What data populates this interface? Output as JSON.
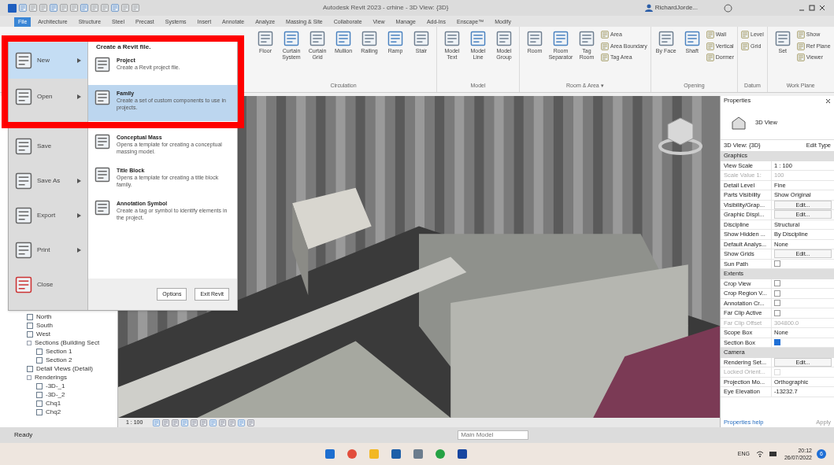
{
  "window": {
    "title": "Autodesk Revit 2023 - crhine - 3D View: {3D}",
    "user": "RichardJorde..."
  },
  "tabs": [
    {
      "label": "File",
      "selected": true
    },
    {
      "label": "Architecture",
      "selected": false
    },
    {
      "label": "Structure",
      "selected": false
    },
    {
      "label": "Steel",
      "selected": false
    },
    {
      "label": "Precast",
      "selected": false
    },
    {
      "label": "Systems",
      "selected": false
    },
    {
      "label": "Insert",
      "selected": false
    },
    {
      "label": "Annotate",
      "selected": false
    },
    {
      "label": "Analyze",
      "selected": false
    },
    {
      "label": "Massing & Site",
      "selected": false
    },
    {
      "label": "Collaborate",
      "selected": false
    },
    {
      "label": "View",
      "selected": false
    },
    {
      "label": "Manage",
      "selected": false
    },
    {
      "label": "Add-Ins",
      "selected": false
    },
    {
      "label": "Enscape™",
      "selected": false
    },
    {
      "label": "Modify",
      "selected": false
    }
  ],
  "ribbon": {
    "groups": [
      {
        "label": "Circulation",
        "tools": [
          {
            "label": "Floor",
            "kind": "large"
          },
          {
            "label": "Curtain System",
            "kind": "large"
          },
          {
            "label": "Curtain Grid",
            "kind": "large"
          },
          {
            "label": "Mullion",
            "kind": "large"
          },
          {
            "label": "Railing",
            "kind": "large"
          },
          {
            "label": "Ramp",
            "kind": "large"
          },
          {
            "label": "Stair",
            "kind": "large"
          }
        ]
      },
      {
        "label": "Model",
        "tools": [
          {
            "label": "Model Text",
            "kind": "large"
          },
          {
            "label": "Model Line",
            "kind": "large"
          },
          {
            "label": "Model Group",
            "kind": "large"
          }
        ]
      },
      {
        "label": "Room & Area ▾",
        "tools": [
          {
            "label": "Room",
            "kind": "large"
          },
          {
            "label": "Room Separator",
            "kind": "large"
          },
          {
            "label": "Tag Room",
            "kind": "large"
          },
          {
            "label": "Area",
            "kind": "small"
          },
          {
            "label": "Area Boundary",
            "kind": "small"
          },
          {
            "label": "Tag Area",
            "kind": "small"
          }
        ]
      },
      {
        "label": "Opening",
        "tools": [
          {
            "label": "By Face",
            "kind": "large"
          },
          {
            "label": "Shaft",
            "kind": "large"
          },
          {
            "label": "Wall",
            "kind": "small"
          },
          {
            "label": "Vertical",
            "kind": "small"
          },
          {
            "label": "Dormer",
            "kind": "small"
          }
        ]
      },
      {
        "label": "Datum",
        "tools": [
          {
            "label": "Level",
            "kind": "small"
          },
          {
            "label": "Grid",
            "kind": "small"
          }
        ]
      },
      {
        "label": "Work Plane",
        "tools": [
          {
            "label": "Set",
            "kind": "large"
          },
          {
            "label": "Show",
            "kind": "small"
          },
          {
            "label": "Ref Plane",
            "kind": "small"
          },
          {
            "label": "Viewer",
            "kind": "small"
          }
        ]
      }
    ]
  },
  "file_menu": {
    "commands": [
      {
        "label": "New",
        "selected": true,
        "submenu": true
      },
      {
        "label": "Open",
        "selected": false,
        "submenu": true
      },
      {
        "label": "Save",
        "selected": false,
        "submenu": false
      },
      {
        "label": "Save As",
        "selected": false,
        "submenu": true
      },
      {
        "label": "Export",
        "selected": false,
        "submenu": true
      },
      {
        "label": "Print",
        "selected": false,
        "submenu": true
      },
      {
        "label": "Close",
        "selected": false,
        "submenu": false
      }
    ],
    "heading": "Create a Revit file.",
    "options": [
      {
        "title": "Project",
        "description": "Create a Revit project file.",
        "selected": false
      },
      {
        "title": "Family",
        "description": "Create a set of custom components to use in projects.",
        "selected": true
      },
      {
        "title": "Conceptual Mass",
        "description": "Opens a template for creating a conceptual massing model.",
        "selected": false
      },
      {
        "title": "Title Block",
        "description": "Opens a template for creating a title block family.",
        "selected": false
      },
      {
        "title": "Annotation Symbol",
        "description": "Create a tag or symbol to identify elements in the project.",
        "selected": false
      }
    ],
    "buttons": [
      "Options",
      "Exit Revit"
    ]
  },
  "project_browser": {
    "items": [
      {
        "label": "North"
      },
      {
        "label": "South"
      },
      {
        "label": "West"
      },
      {
        "label": "Sections (Building Sect",
        "children": [
          {
            "label": "Section 1"
          },
          {
            "label": "Section 2"
          }
        ]
      },
      {
        "label": "Detail Views (Detail)"
      },
      {
        "label": "Renderings",
        "children": [
          {
            "label": "-3D-_1"
          },
          {
            "label": "-3D-_2"
          },
          {
            "label": "Chq1"
          },
          {
            "label": "Chq2"
          }
        ]
      }
    ]
  },
  "view_scale": "1 : 100",
  "properties": {
    "title": "Properties",
    "type": "3D View",
    "instance": "3D View: {3D}",
    "edit_type": "Edit Type",
    "sections": [
      {
        "label": "Graphics",
        "rows": [
          {
            "name": "View Scale",
            "kind": "text",
            "value": "1 : 100",
            "disabled": false
          },
          {
            "name": "Scale Value    1:",
            "kind": "text",
            "value": "100",
            "disabled": true
          },
          {
            "name": "Detail Level",
            "kind": "text",
            "value": "Fine",
            "disabled": false
          },
          {
            "name": "Parts Visibility",
            "kind": "text",
            "value": "Show Original",
            "disabled": false
          },
          {
            "name": "Visibility/Grap...",
            "kind": "button",
            "value": "Edit...",
            "disabled": false
          },
          {
            "name": "Graphic Displ...",
            "kind": "button",
            "value": "Edit...",
            "disabled": false
          },
          {
            "name": "Discipline",
            "kind": "text",
            "value": "Structural",
            "disabled": false
          },
          {
            "name": "Show Hidden ...",
            "kind": "text",
            "value": "By Discipline",
            "disabled": false
          },
          {
            "name": "Default Analys...",
            "kind": "text",
            "value": "None",
            "disabled": false
          },
          {
            "name": "Show Grids",
            "kind": "button",
            "value": "Edit...",
            "disabled": false
          },
          {
            "name": "Sun Path",
            "kind": "checkbox",
            "checked": false,
            "disabled": false
          }
        ]
      },
      {
        "label": "Extents",
        "rows": [
          {
            "name": "Crop View",
            "kind": "checkbox",
            "checked": false,
            "disabled": false
          },
          {
            "name": "Crop Region V...",
            "kind": "checkbox",
            "checked": false,
            "disabled": false
          },
          {
            "name": "Annotation Cr...",
            "kind": "checkbox",
            "checked": false,
            "disabled": false
          },
          {
            "name": "Far Clip Active",
            "kind": "checkbox",
            "checked": false,
            "disabled": false
          },
          {
            "name": "Far Clip Offset",
            "kind": "text",
            "value": "304800.0",
            "disabled": true
          },
          {
            "name": "Scope Box",
            "kind": "text",
            "value": "None",
            "disabled": false
          },
          {
            "name": "Section Box",
            "kind": "checkbox",
            "checked": true,
            "disabled": false
          }
        ]
      },
      {
        "label": "Camera",
        "rows": [
          {
            "name": "Rendering Set...",
            "kind": "button",
            "value": "Edit...",
            "disabled": false
          },
          {
            "name": "Locked Orient...",
            "kind": "checkbox",
            "checked": false,
            "disabled": true
          },
          {
            "name": "Projection Mo...",
            "kind": "text",
            "value": "Orthographic",
            "disabled": false
          },
          {
            "name": "Eye Elevation",
            "kind": "text",
            "value": "-13232.7",
            "disabled": false
          }
        ]
      }
    ],
    "help": "Properties help",
    "apply": "Apply"
  },
  "status_bar": {
    "text": "Ready",
    "model": "Main Model"
  },
  "taskbar": {
    "language": "ENG",
    "time": "20:12",
    "date": "26/07/2022",
    "notifications": "6"
  }
}
